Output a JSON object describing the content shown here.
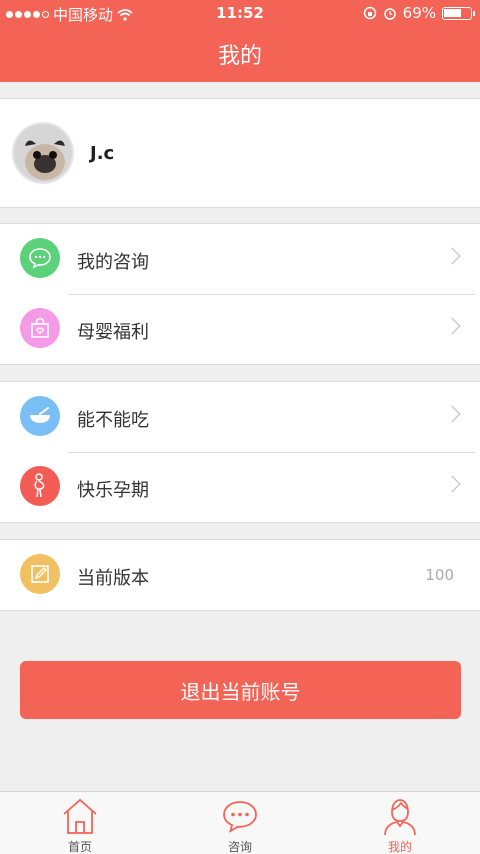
{
  "status_bar": {
    "carrier": "中国移动",
    "time": "11:52",
    "battery": "69%",
    "battery_level": 0.69
  },
  "header": {
    "title": "我的"
  },
  "profile": {
    "username": "J.c"
  },
  "menu": {
    "group1": [
      {
        "label": "我的咨询",
        "icon": "chat-bubble-icon",
        "color": "#5bd27a"
      },
      {
        "label": "母婴福利",
        "icon": "shopping-bag-icon",
        "color": "#f49ae6"
      }
    ],
    "group2": [
      {
        "label": "能不能吃",
        "icon": "bowl-icon",
        "color": "#79bff5"
      },
      {
        "label": "快乐孕期",
        "icon": "pregnant-icon",
        "color": "#f25c54"
      }
    ],
    "group3": [
      {
        "label": "当前版本",
        "value": "100",
        "icon": "edit-icon",
        "color": "#f1c060"
      }
    ]
  },
  "logout_label": "退出当前账号",
  "tabs": [
    {
      "label": "首页",
      "icon": "home-icon"
    },
    {
      "label": "咨询",
      "icon": "chat-bubble-icon"
    },
    {
      "label": "我的",
      "icon": "user-icon",
      "active": true
    }
  ],
  "colors": {
    "accent": "#f36356",
    "background": "#efefef"
  }
}
